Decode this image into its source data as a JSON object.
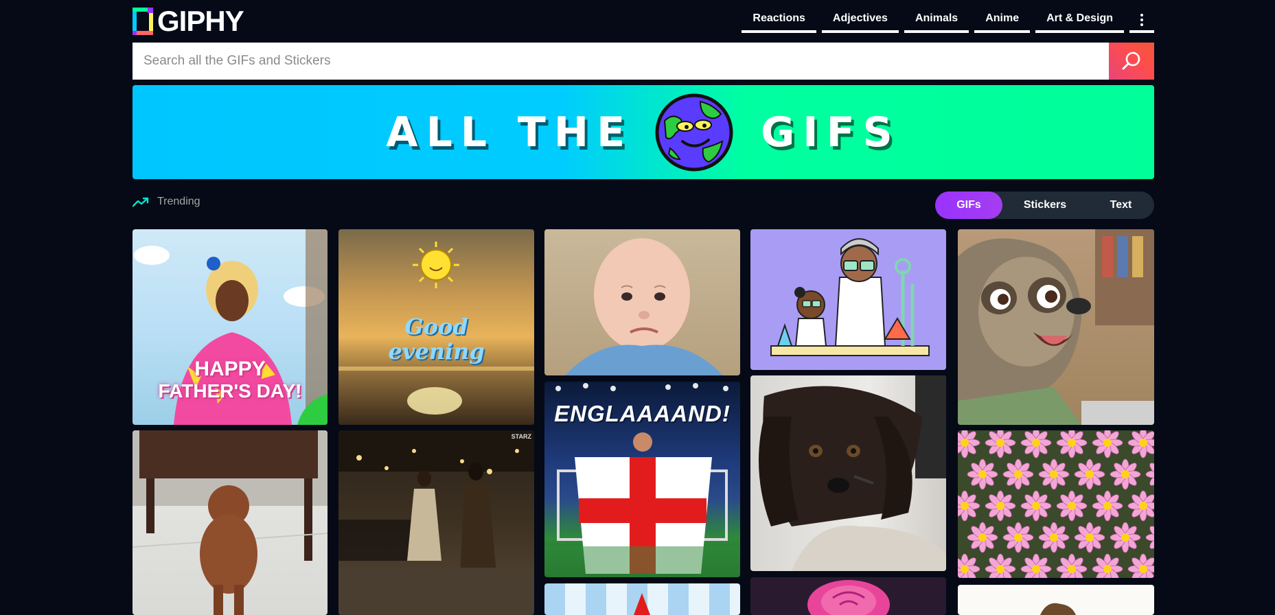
{
  "brand": {
    "name": "GIPHY"
  },
  "nav": {
    "items": [
      {
        "label": "Reactions"
      },
      {
        "label": "Adjectives"
      },
      {
        "label": "Animals"
      },
      {
        "label": "Anime"
      },
      {
        "label": "Art & Design"
      }
    ],
    "more_icon": "more-vertical-icon"
  },
  "search": {
    "placeholder": "Search all the GIFs and Stickers",
    "value": "",
    "button_icon": "search-icon"
  },
  "banner": {
    "text_left": "ALL THE",
    "text_right": "GIFS",
    "globe_icon": "globe-mascot-icon"
  },
  "trending": {
    "label": "Trending",
    "icon": "trending-up-icon"
  },
  "content_toggle": {
    "options": [
      {
        "label": "GIFs",
        "selected": true
      },
      {
        "label": "Stickers",
        "selected": false
      },
      {
        "label": "Text",
        "selected": false
      }
    ]
  },
  "gifs": {
    "fathers_day": {
      "line1": "HAPPY",
      "line2": "FATHER'S DAY!"
    },
    "good_evening": {
      "line1": "Good",
      "line2": "evening"
    },
    "england": {
      "caption": "ENGLAAAAND!"
    },
    "watermark": "STARZ"
  },
  "colors": {
    "background": "#050a16",
    "accent_purple": "#9933ff",
    "search_red": "#ff4d4d",
    "banner_blue": "#00ccff",
    "banner_green": "#00ff99"
  }
}
